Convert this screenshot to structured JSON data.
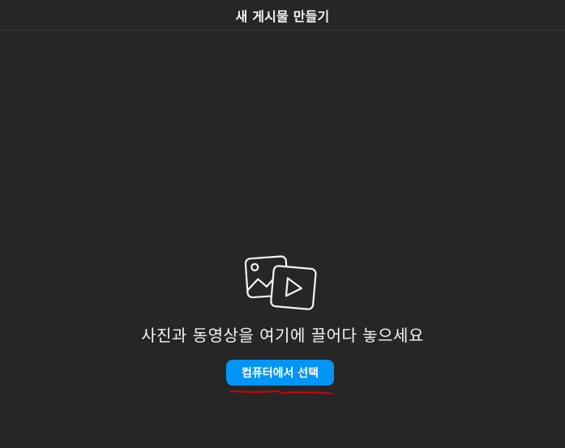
{
  "header": {
    "title": "새 게시물 만들기"
  },
  "main": {
    "icon": "photo-video-icon",
    "drop_text": "사진과 동영상을 여기에 끌어다 놓으세요",
    "select_button_label": "컴퓨터에서 선택"
  },
  "colors": {
    "background": "#262626",
    "accent": "#0095f6",
    "text": "#f5f5f5",
    "annotation": "#d40000"
  }
}
